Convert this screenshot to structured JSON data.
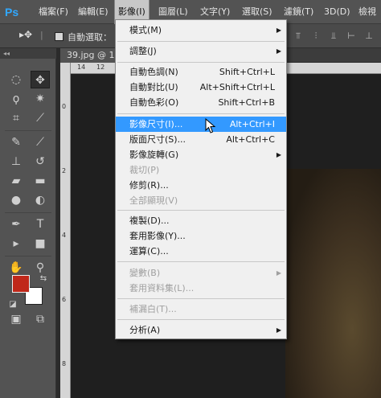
{
  "app": {
    "logo": "Ps"
  },
  "menubar": {
    "items": [
      {
        "label": "檔案(F)"
      },
      {
        "label": "編輯(E)"
      },
      {
        "label": "影像(I)"
      },
      {
        "label": "圖層(L)"
      },
      {
        "label": "文字(Y)"
      },
      {
        "label": "選取(S)"
      },
      {
        "label": "濾鏡(T)"
      },
      {
        "label": "3D(D)"
      },
      {
        "label": "檢視"
      }
    ],
    "active_index": 2
  },
  "options": {
    "tool_icon": "move-tool-icon",
    "auto_select_label": "自動選取："
  },
  "document": {
    "tab_label": "39.jpg @ 16",
    "ruler_top": [
      "14",
      "12"
    ],
    "ruler_left": [
      "0",
      "2",
      "4",
      "6",
      "8"
    ]
  },
  "toolbox": {
    "tools": [
      "marquee-icon",
      "move-tool-icon",
      "lasso-icon",
      "magic-wand-icon",
      "crop-icon",
      "eyedropper-icon",
      "healing-brush-icon",
      "brush-icon",
      "clone-stamp-icon",
      "history-brush-icon",
      "eraser-icon",
      "gradient-icon",
      "blur-icon",
      "dodge-icon",
      "pen-icon",
      "type-icon",
      "path-select-icon",
      "shape-icon",
      "hand-icon",
      "zoom-icon"
    ],
    "foreground_color": "#c0281a",
    "background_color": "#ffffff"
  },
  "image_menu": {
    "items": [
      {
        "label": "模式(M)",
        "submenu": true
      },
      {
        "label": "調整(J)",
        "submenu": true
      },
      {
        "label": "自動色調(N)",
        "shortcut": "Shift+Ctrl+L"
      },
      {
        "label": "自動對比(U)",
        "shortcut": "Alt+Shift+Ctrl+L"
      },
      {
        "label": "自動色彩(O)",
        "shortcut": "Shift+Ctrl+B"
      },
      {
        "label": "影像尺寸(I)...",
        "shortcut": "Alt+Ctrl+I",
        "highlighted": true
      },
      {
        "label": "版面尺寸(S)...",
        "shortcut": "Alt+Ctrl+C"
      },
      {
        "label": "影像旋轉(G)",
        "submenu": true
      },
      {
        "label": "裁切(P)",
        "disabled": true
      },
      {
        "label": "修剪(R)..."
      },
      {
        "label": "全部顯現(V)",
        "disabled": true
      },
      {
        "label": "複製(D)..."
      },
      {
        "label": "套用影像(Y)..."
      },
      {
        "label": "運算(C)..."
      },
      {
        "label": "變數(B)",
        "submenu": true,
        "disabled": true
      },
      {
        "label": "套用資料集(L)...",
        "disabled": true
      },
      {
        "label": "補漏白(T)...",
        "disabled": true
      },
      {
        "label": "分析(A)",
        "submenu": true
      }
    ]
  }
}
